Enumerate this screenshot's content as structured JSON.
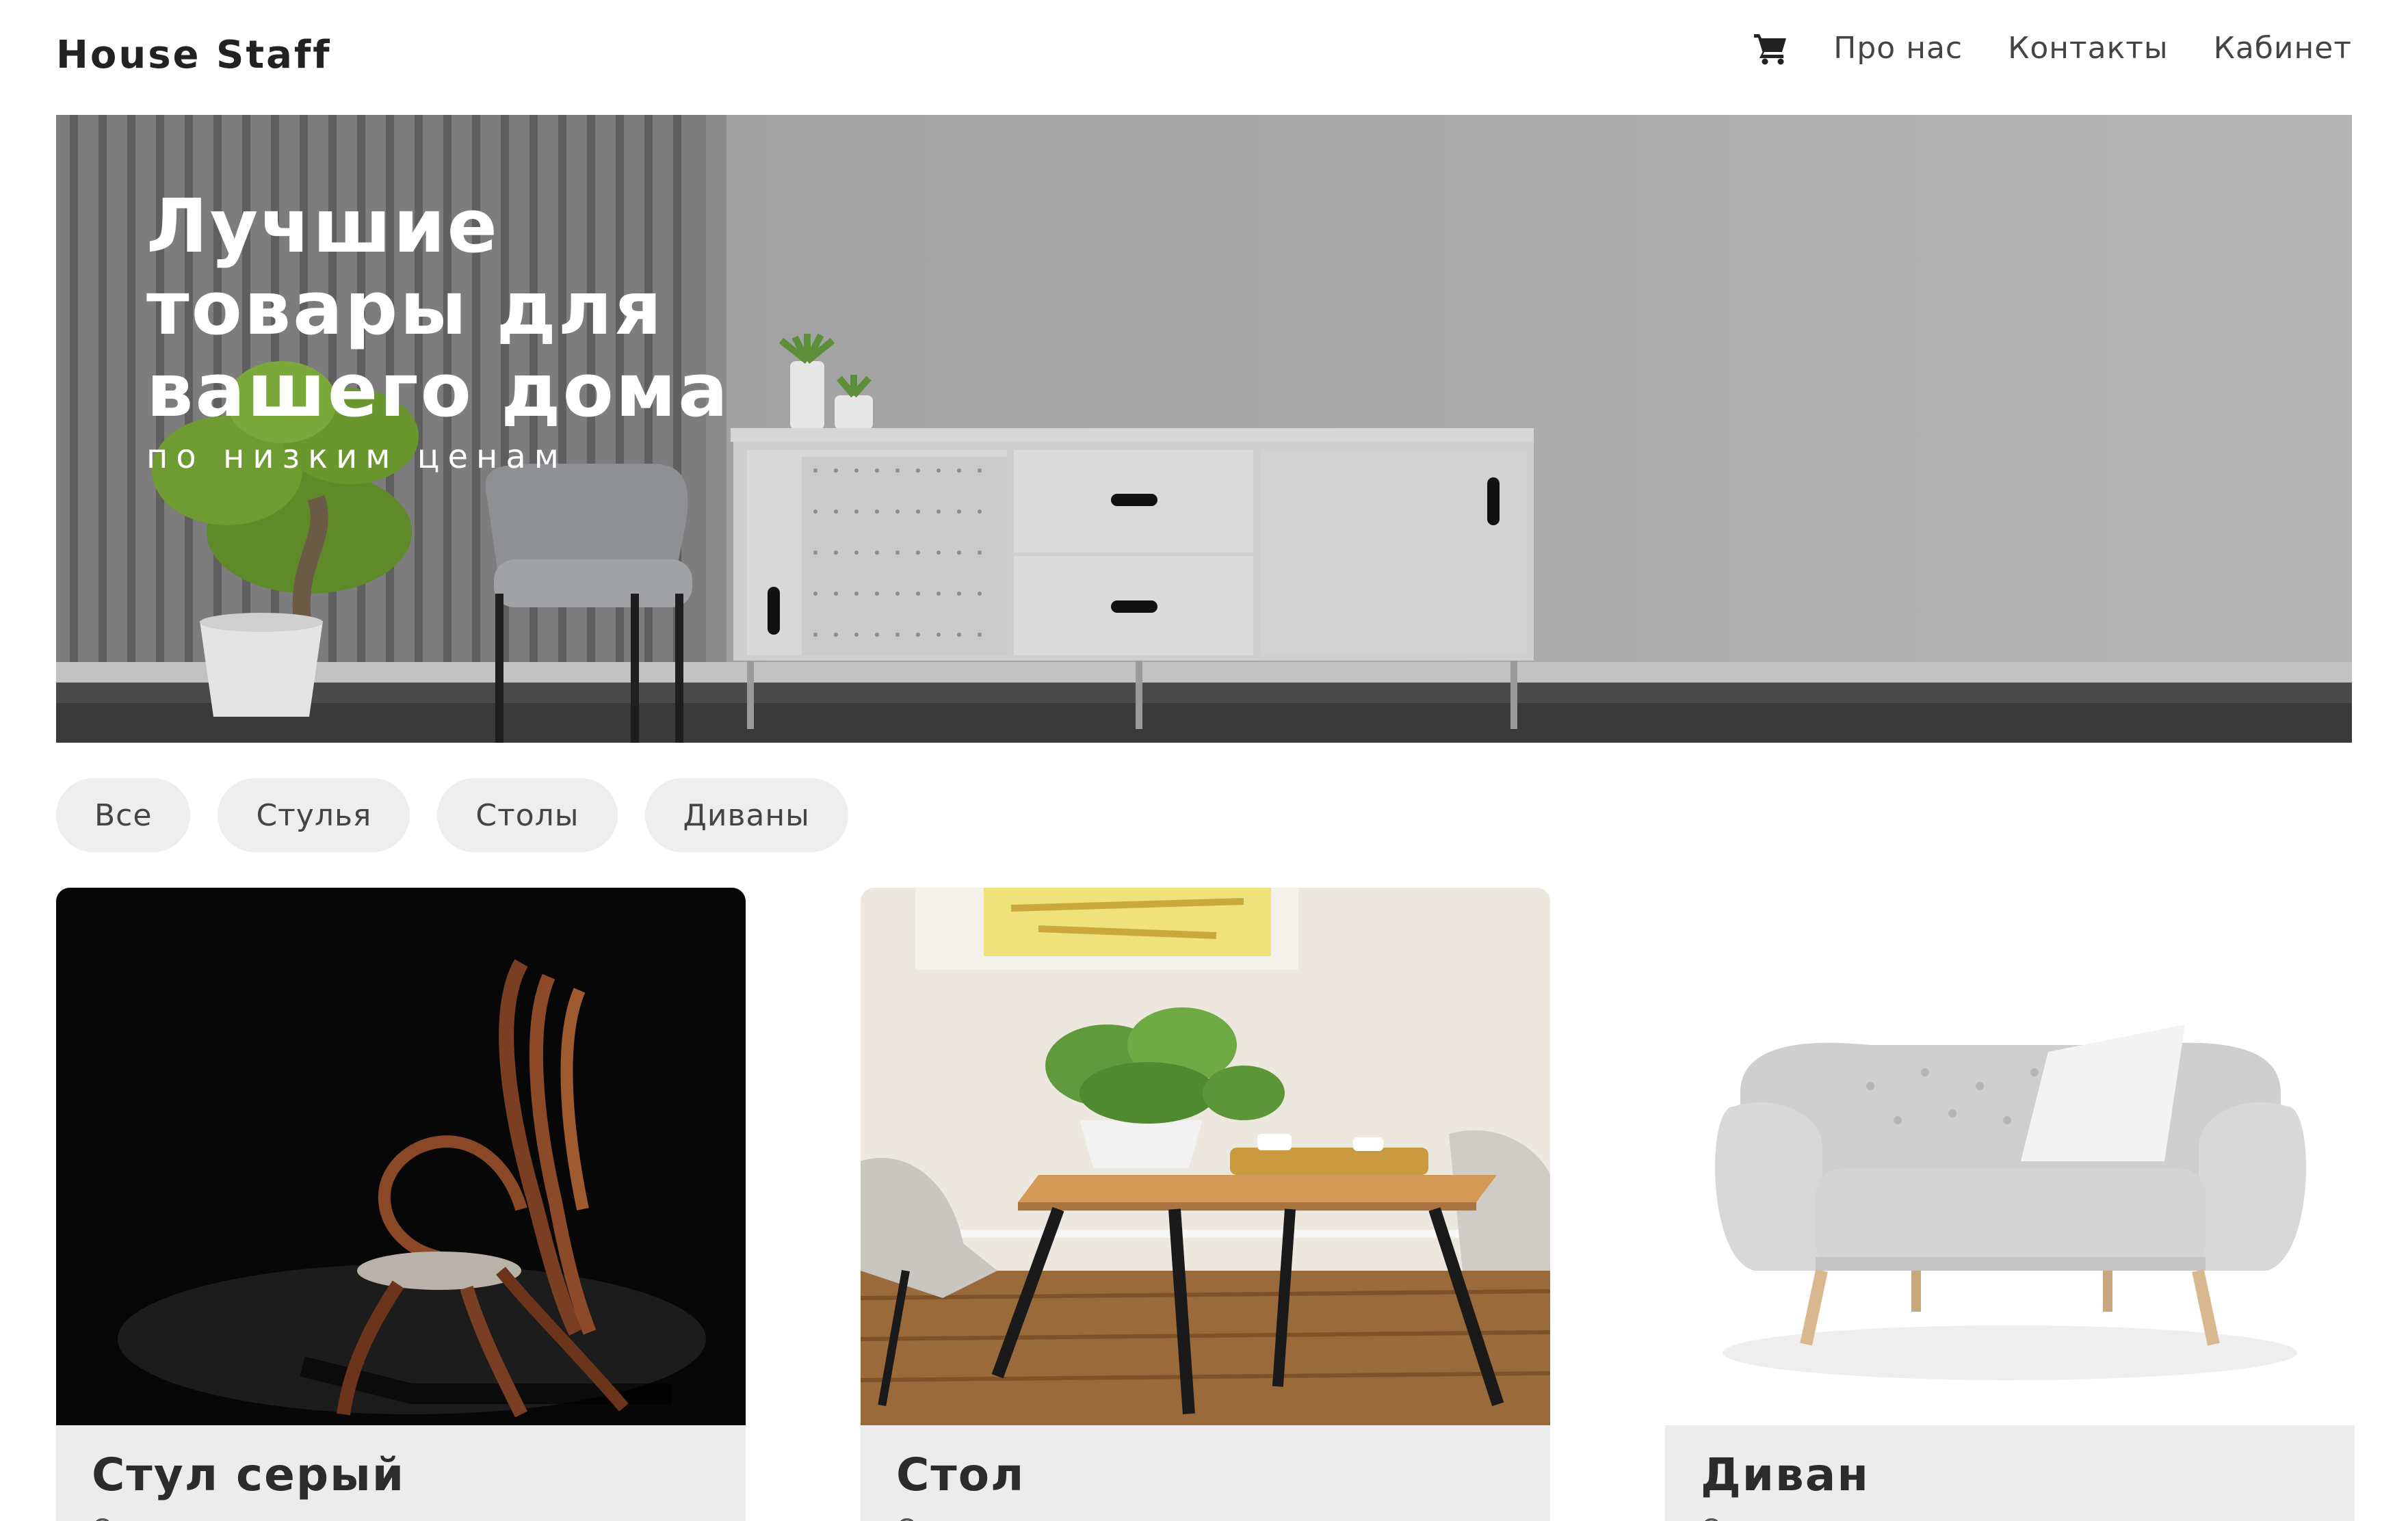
{
  "header": {
    "logo": "House Staff",
    "cart_icon": "shopping-cart-icon",
    "nav": [
      "Про нас",
      "Контакты",
      "Кабинет"
    ]
  },
  "hero": {
    "title": "Лучшие товары для вашего дома",
    "subtitle": "по низким ценам"
  },
  "filters": [
    "Все",
    "Стулья",
    "Столы",
    "Диваны"
  ],
  "products": [
    {
      "title": "Стул серый",
      "description": "Описание лучшего товара на свете",
      "image": "wooden-chair-photo"
    },
    {
      "title": "Стол",
      "description": "Описание лучшего товара на свете",
      "image": "dining-table-photo"
    },
    {
      "title": "Диван",
      "description": "Описание лучшего товара на свете",
      "image": "sofa-photo"
    }
  ],
  "colors": {
    "text": "#222222",
    "chip_bg": "#eeeeee",
    "card_bg": "#ececec",
    "hero_bg": "#a9a9a9"
  }
}
